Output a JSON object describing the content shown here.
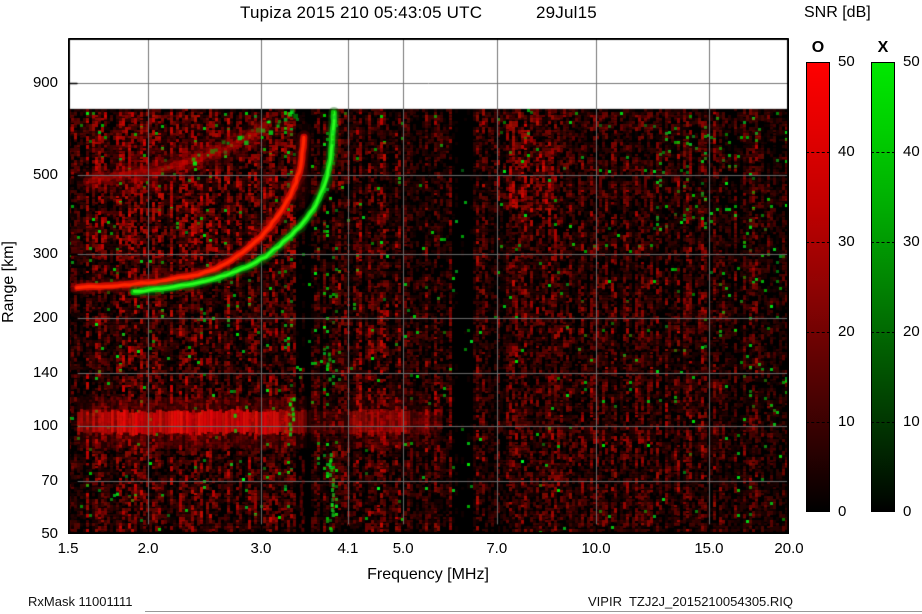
{
  "header": {
    "title": "Tupiza 2015 210 05:43:05 UTC",
    "date": "29Jul15"
  },
  "footer": {
    "rx_mask": "RxMask 11001111",
    "file_id": "VIPIR  TZJ2J_2015210054305.RIQ"
  },
  "colorbar_panel": {
    "title": "SNR [dB]",
    "min": 0,
    "max": 50,
    "bars": [
      {
        "id": "o",
        "label": "O",
        "top_color": "#ff0000"
      },
      {
        "id": "x",
        "label": "X",
        "top_color": "#00dd00"
      }
    ],
    "ticks": [
      {
        "label": "50",
        "value": 50,
        "dash": false
      },
      {
        "label": "40",
        "value": 40,
        "dash": true
      },
      {
        "label": "30",
        "value": 30,
        "dash": true
      },
      {
        "label": "20",
        "value": 20,
        "dash": true
      },
      {
        "label": "10",
        "value": 10,
        "dash": true
      },
      {
        "label": "0",
        "value": 0,
        "dash": false
      }
    ]
  },
  "chart_data": {
    "type": "heatmap",
    "title": "Tupiza 2015 210 05:43:05 UTC",
    "xlabel": "Frequency [MHz]",
    "ylabel": "Range [km]",
    "x_scale": "log",
    "y_scale": "log",
    "xlim": [
      1.5,
      20
    ],
    "ylim": [
      50,
      1200
    ],
    "x_ticks": [
      {
        "label": "1.5",
        "value": 1.5,
        "grid": false
      },
      {
        "label": "2.0",
        "value": 2.0,
        "grid": true
      },
      {
        "label": "3.0",
        "value": 3.0,
        "grid": true
      },
      {
        "label": "4.1",
        "value": 4.1,
        "grid": true
      },
      {
        "label": "5.0",
        "value": 5.0,
        "grid": true
      },
      {
        "label": "7.0",
        "value": 7.0,
        "grid": true
      },
      {
        "label": "10.0",
        "value": 10.0,
        "grid": true
      },
      {
        "label": "15.0",
        "value": 15.0,
        "grid": true
      },
      {
        "label": "20.0",
        "value": 20.0,
        "grid": false
      }
    ],
    "y_ticks": [
      {
        "label": "50",
        "value": 50,
        "grid": false
      },
      {
        "label": "70",
        "value": 70,
        "grid": true
      },
      {
        "label": "100",
        "value": 100,
        "grid": true
      },
      {
        "label": "140",
        "value": 140,
        "grid": true
      },
      {
        "label": "200",
        "value": 200,
        "grid": true
      },
      {
        "label": "300",
        "value": 300,
        "grid": true
      },
      {
        "label": "500",
        "value": 500,
        "grid": true
      },
      {
        "label": "900",
        "value": 900,
        "grid": true
      }
    ],
    "snr_scale": {
      "min": 0,
      "max": 50,
      "o_color": "#ff0000",
      "x_color": "#00dd00"
    },
    "data_top_km": 762,
    "o_trace": [
      [
        1.55,
        243
      ],
      [
        1.8,
        246
      ],
      [
        2.0,
        250
      ],
      [
        2.2,
        256
      ],
      [
        2.4,
        264
      ],
      [
        2.55,
        274
      ],
      [
        2.7,
        289
      ],
      [
        2.85,
        311
      ],
      [
        3.0,
        336
      ],
      [
        3.1,
        359
      ],
      [
        3.2,
        387
      ],
      [
        3.3,
        422
      ],
      [
        3.38,
        462
      ],
      [
        3.44,
        508
      ],
      [
        3.47,
        552
      ],
      [
        3.49,
        598
      ],
      [
        3.5,
        635
      ]
    ],
    "x_trace": [
      [
        1.9,
        236
      ],
      [
        2.1,
        241
      ],
      [
        2.3,
        247
      ],
      [
        2.5,
        255
      ],
      [
        2.7,
        266
      ],
      [
        2.9,
        281
      ],
      [
        3.05,
        296
      ],
      [
        3.2,
        316
      ],
      [
        3.35,
        340
      ],
      [
        3.5,
        370
      ],
      [
        3.62,
        400
      ],
      [
        3.72,
        440
      ],
      [
        3.79,
        485
      ],
      [
        3.84,
        535
      ],
      [
        3.87,
        590
      ],
      [
        3.885,
        645
      ],
      [
        3.895,
        700
      ],
      [
        3.9,
        745
      ]
    ],
    "o_trace_2hop": [
      [
        1.62,
        485
      ],
      [
        1.85,
        498
      ],
      [
        2.1,
        520
      ],
      [
        2.35,
        548
      ],
      [
        2.6,
        585
      ],
      [
        2.8,
        622
      ],
      [
        2.95,
        658
      ],
      [
        3.05,
        690
      ]
    ],
    "x_trace_2hop_dots": [
      [
        2.35,
        565
      ],
      [
        2.5,
        582
      ],
      [
        2.65,
        602
      ],
      [
        2.8,
        628
      ],
      [
        2.95,
        655
      ],
      [
        3.1,
        685
      ],
      [
        3.22,
        712
      ],
      [
        3.32,
        738
      ]
    ],
    "e_layer": {
      "km_core": [
        95,
        110
      ],
      "km_halo": [
        86,
        120
      ],
      "segments": [
        [
          1.55,
          1.75,
          0.75
        ],
        [
          1.75,
          3.28,
          1.0
        ],
        [
          3.28,
          3.52,
          0.5
        ],
        [
          3.52,
          4.12,
          0.16
        ],
        [
          4.12,
          4.55,
          0.55
        ],
        [
          4.55,
          5.1,
          0.62
        ],
        [
          5.1,
          5.45,
          0.35
        ],
        [
          5.45,
          5.75,
          0.15
        ]
      ]
    },
    "diffuse_patches": [
      {
        "f": 3.52,
        "fw": 0.08,
        "km": 585,
        "kmh": 120,
        "a": 0.22
      },
      {
        "f": 3.45,
        "fw": 0.14,
        "km": 470,
        "kmh": 80,
        "a": 0.25
      },
      {
        "f": 2.35,
        "fw": 0.85,
        "km": 590,
        "kmh": 110,
        "a": 0.1
      },
      {
        "f": 2.05,
        "fw": 0.5,
        "km": 480,
        "kmh": 60,
        "a": 0.12
      }
    ],
    "rfi_green_columns": [
      {
        "f0": 3.76,
        "f1": 3.97,
        "density": 0.09
      },
      {
        "f0": 3.27,
        "f1": 3.37,
        "density": 0.045
      }
    ],
    "green_streaks": [
      {
        "f": 3.86,
        "km0": 51,
        "km1": 84
      },
      {
        "f": 3.9,
        "km0": 600,
        "km1": 755
      },
      {
        "f": 3.82,
        "km0": 130,
        "km1": 160
      },
      {
        "f": 3.35,
        "km0": 95,
        "km1": 120
      },
      {
        "f": 2.72,
        "km0": 97,
        "km1": 108
      }
    ],
    "red_columns": [
      {
        "f": 3.47,
        "km0": 52,
        "km1": 145,
        "a": 0.5
      }
    ],
    "noise": {
      "red_density": 0.9,
      "green_density": 0.012,
      "quiet_bands": [
        [
          3.42,
          3.6
        ],
        [
          5.95,
          6.45
        ]
      ],
      "boost_regions": [
        {
          "f0": 1.55,
          "f1": 3.6,
          "km0": 300,
          "km1": 760,
          "gain": 2.0
        },
        {
          "f0": 1.55,
          "f1": 3.4,
          "km0": 50,
          "km1": 300,
          "gain": 1.35
        },
        {
          "f0": 6.8,
          "f1": 8.6,
          "km0": 400,
          "km1": 760,
          "gain": 1.7
        },
        {
          "f0": 4.2,
          "f1": 5.8,
          "km0": 50,
          "km1": 220,
          "gain": 1.3
        }
      ],
      "green_regions": [
        {
          "f0": 12.3,
          "f1": 16.2,
          "km0": 350,
          "km1": 680,
          "gain": 5
        },
        {
          "f0": 16.5,
          "f1": 20,
          "km0": 80,
          "km1": 760,
          "gain": 2.5
        },
        {
          "f0": 6.9,
          "f1": 8.0,
          "km0": 520,
          "km1": 760,
          "gain": 3
        },
        {
          "f0": 1.5,
          "f1": 3.9,
          "km0": 55,
          "km1": 760,
          "gain": 1.6
        }
      ]
    }
  }
}
